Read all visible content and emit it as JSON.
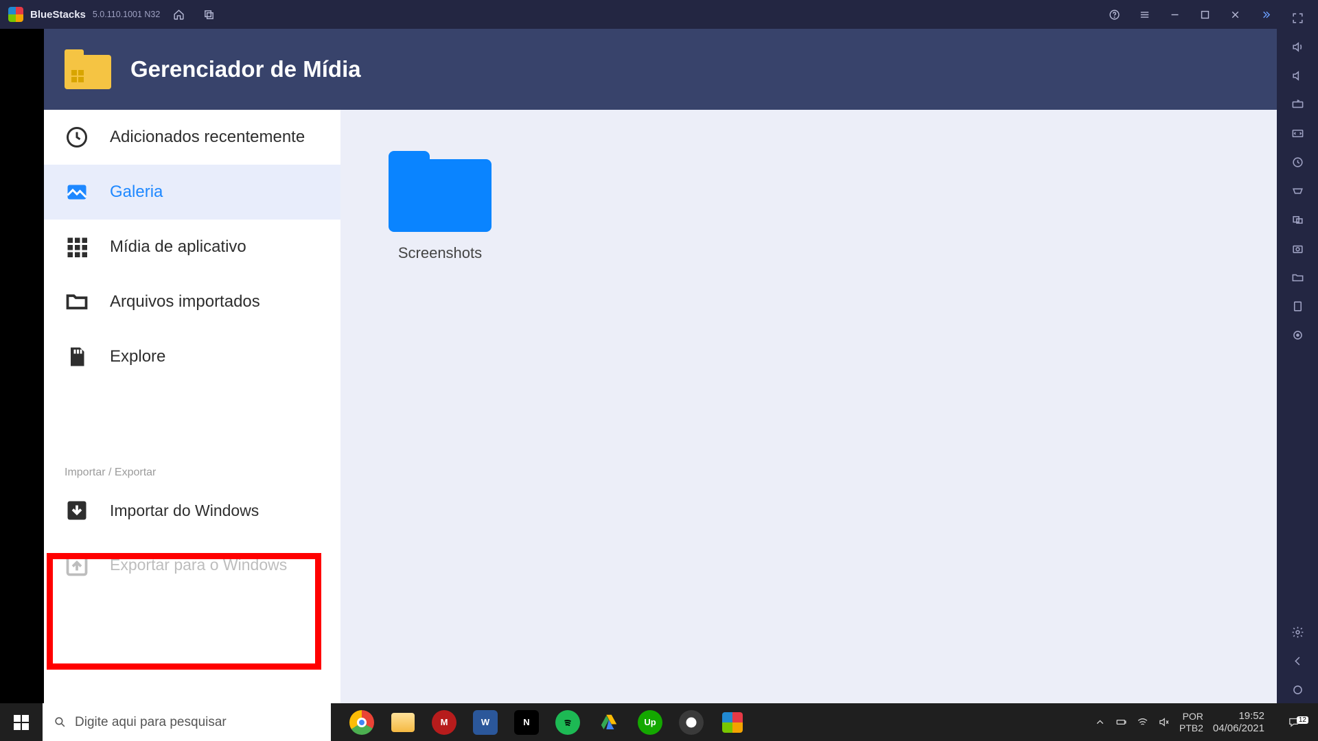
{
  "bluestacks": {
    "app_name": "BlueStacks",
    "version": "5.0.110.1001 N32"
  },
  "media_manager": {
    "title": "Gerenciador de Mídia",
    "nav": {
      "recent": "Adicionados recentemente",
      "gallery": "Galeria",
      "app_media": "Mídia de aplicativo",
      "imported": "Arquivos importados",
      "explore": "Explore"
    },
    "section_header": "Importar / Exportar",
    "import_win": "Importar do Windows",
    "export_win": "Exportar para o Windows",
    "folder_name": "Screenshots"
  },
  "taskbar": {
    "search_placeholder": "Digite aqui para pesquisar",
    "lang1": "POR",
    "lang2": "PTB2",
    "time": "19:52",
    "date": "04/06/2021",
    "notif_count": "12"
  }
}
